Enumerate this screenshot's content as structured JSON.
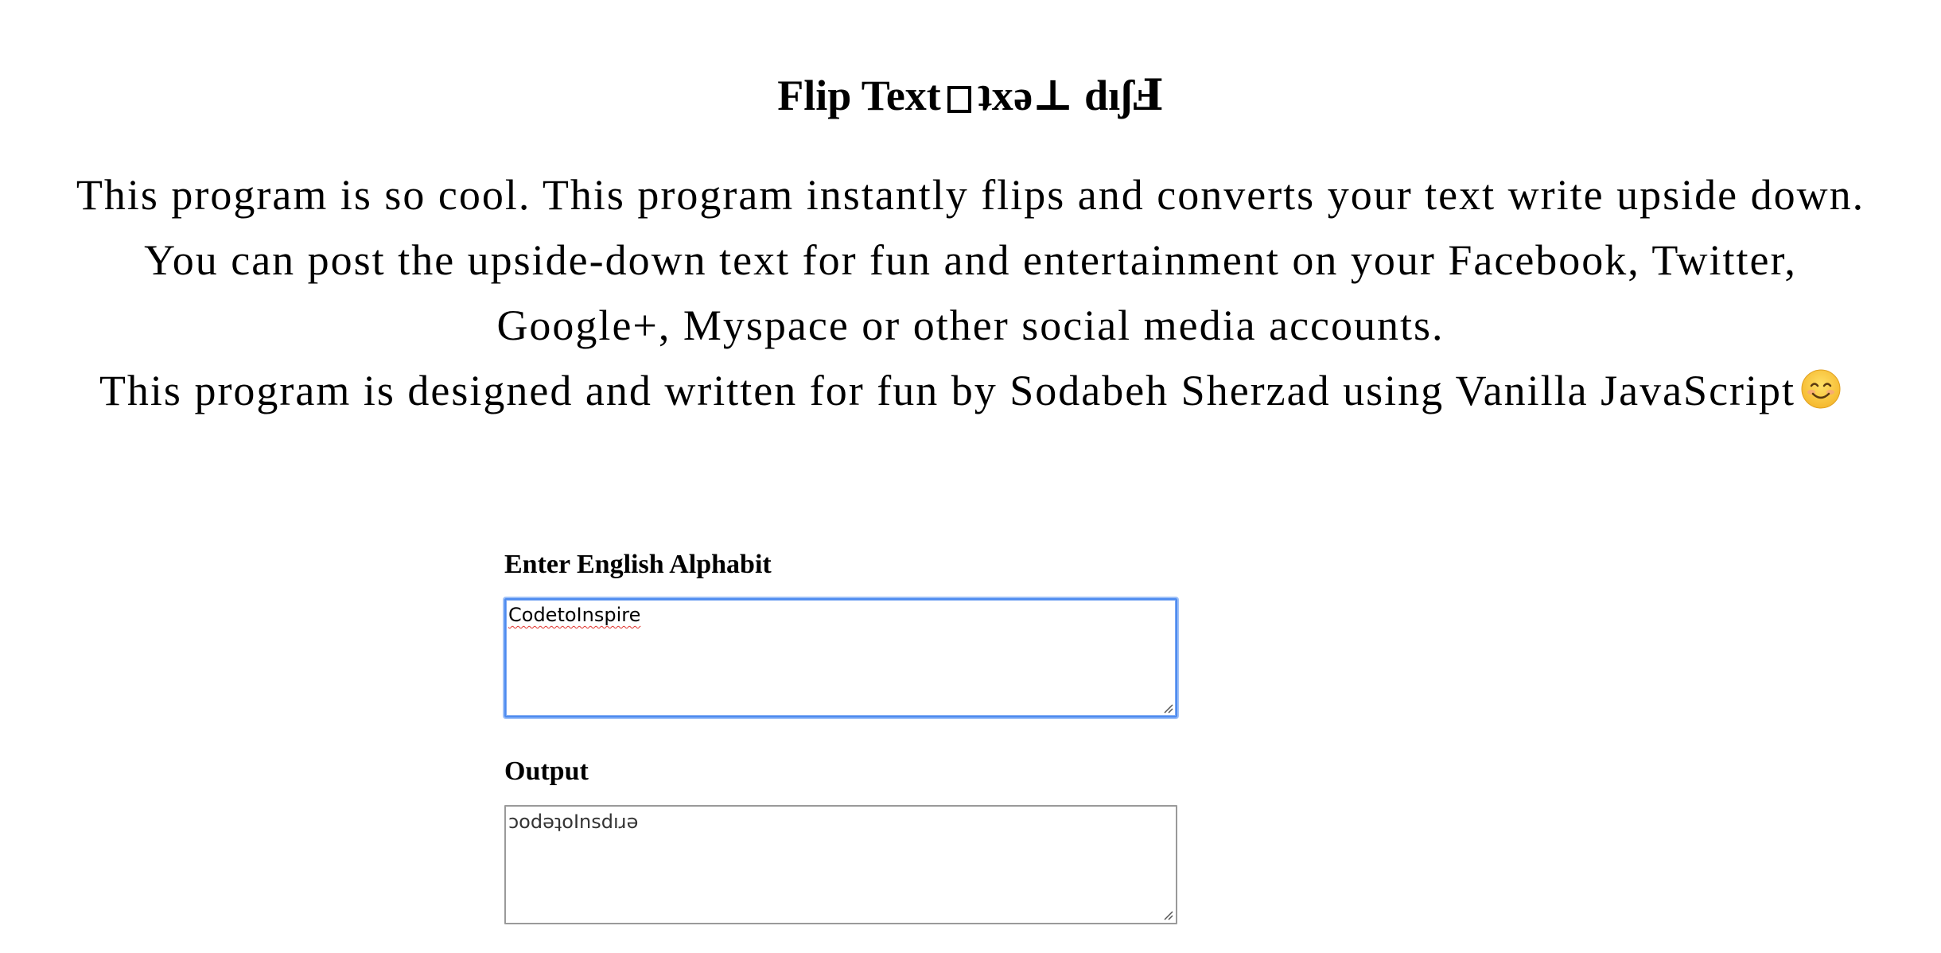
{
  "page": {
    "title_left": "Flip Text",
    "title_right": "ʇxǝ⊥ dıʃℲ",
    "intro_lines": [
      "This program is so cool. This program instantly flips and converts your text write upside down.",
      "You can post the upside-down text for fun and entertainment on your Facebook, Twitter,",
      "Google+, Myspace or other social media accounts.",
      "This program is designed and written for fun by Sodabeh Sherzad using Vanilla JavaScript"
    ]
  },
  "form": {
    "input_label": "Enter English Alphabit",
    "input_value": "CodetoInspire",
    "output_label": "Output",
    "output_value": "ɔodǝʇoInsdıɹǝ"
  },
  "icons": {
    "emoji": "smiling-face-icon",
    "resize": "resize-grip-icon"
  },
  "colors": {
    "focus_border": "#4d8bf0",
    "spellcheck_underline": "#e0312b"
  }
}
